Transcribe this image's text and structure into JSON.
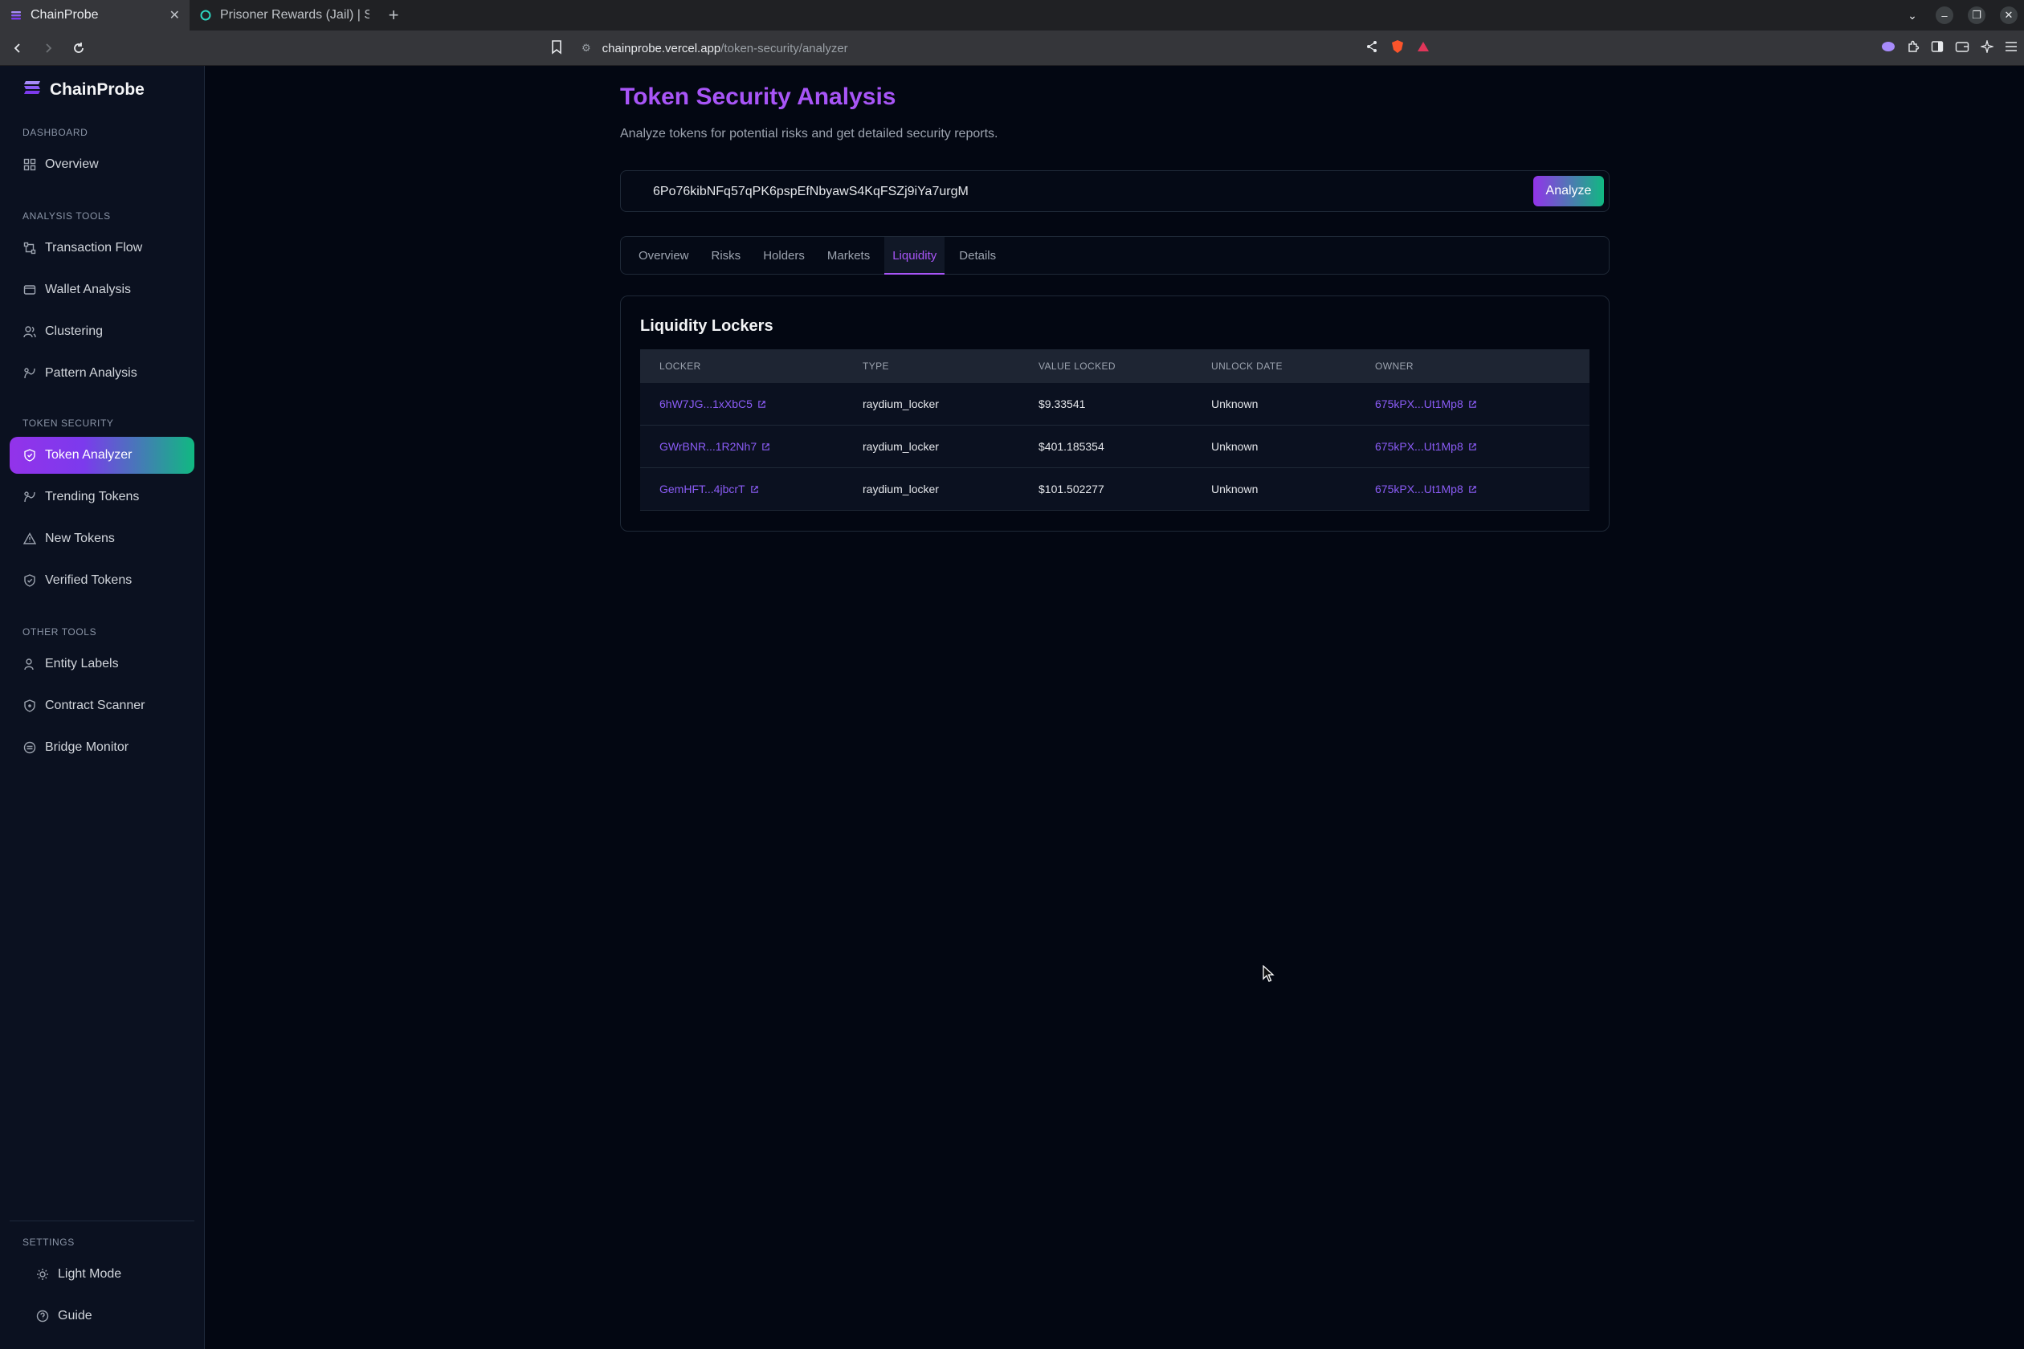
{
  "browser": {
    "tabs": [
      {
        "title": "ChainProbe",
        "active": true
      },
      {
        "title": "Prisoner Rewards (Jail) | Sol",
        "active": false
      }
    ],
    "new_tab": "+",
    "url_host": "chainprobe.vercel.app",
    "url_path": "/token-security/analyzer"
  },
  "sidebar": {
    "brand": "ChainProbe",
    "sections": {
      "dashboard": "DASHBOARD",
      "analysis": "ANALYSIS TOOLS",
      "token_security": "TOKEN SECURITY",
      "other": "OTHER TOOLS",
      "settings": "SETTINGS"
    },
    "items": {
      "overview": "Overview",
      "transaction_flow": "Transaction Flow",
      "wallet_analysis": "Wallet Analysis",
      "clustering": "Clustering",
      "pattern_analysis": "Pattern Analysis",
      "token_analyzer": "Token Analyzer",
      "trending_tokens": "Trending Tokens",
      "new_tokens": "New Tokens",
      "verified_tokens": "Verified Tokens",
      "entity_labels": "Entity Labels",
      "contract_scanner": "Contract Scanner",
      "bridge_monitor": "Bridge Monitor",
      "light_mode": "Light Mode",
      "guide": "Guide"
    },
    "active_item": "Token Analyzer"
  },
  "main": {
    "title": "Token Security Analysis",
    "subtitle": "Analyze tokens for potential risks and get detailed security reports.",
    "search": {
      "value": "6Po76kibNFq57qPK6pspEfNbyawS4KqFSZj9iYa7urgM",
      "button": "Analyze"
    },
    "tabs": [
      "Overview",
      "Risks",
      "Holders",
      "Markets",
      "Liquidity",
      "Details"
    ],
    "active_tab": "Liquidity",
    "lockers": {
      "title": "Liquidity Lockers",
      "columns": [
        "LOCKER",
        "TYPE",
        "VALUE LOCKED",
        "UNLOCK DATE",
        "OWNER"
      ],
      "rows": [
        {
          "locker": "6hW7JG...1xXbC5",
          "type": "raydium_locker",
          "value": "$9.33541",
          "unlock": "Unknown",
          "owner": "675kPX...Ut1Mp8"
        },
        {
          "locker": "GWrBNR...1R2Nh7",
          "type": "raydium_locker",
          "value": "$401.185354",
          "unlock": "Unknown",
          "owner": "675kPX...Ut1Mp8"
        },
        {
          "locker": "GemHFT...4jbcrT",
          "type": "raydium_locker",
          "value": "$101.502277",
          "unlock": "Unknown",
          "owner": "675kPX...Ut1Mp8"
        }
      ]
    }
  },
  "colors": {
    "accent": "#a855f7",
    "accent_green": "#10b981",
    "background": "#030712",
    "link": "#8b5cf6"
  }
}
